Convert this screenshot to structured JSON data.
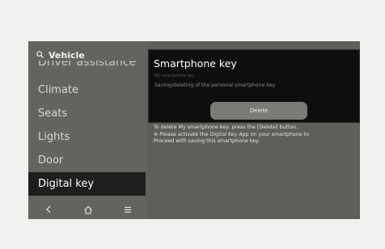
{
  "sidebar": {
    "search_label": "Vehicle",
    "cut_item": "Driver assistance",
    "items": [
      "Climate",
      "Seats",
      "Lights",
      "Door",
      "Digital key"
    ],
    "active_index": 4
  },
  "dialog": {
    "title": "Smartphone key",
    "faded_line": "My smartphone key",
    "body": "Saving/deleting of the personal smartphone key",
    "delete_label": "Delete"
  },
  "info": {
    "line1": "To delete My smartphone key, press the [Delete] button.",
    "line2": "※ Please activate the Digital Key App on your smartphone to",
    "line3": "Proceed with saving this smartphone key."
  },
  "colors": {
    "screen": "#5e5f5b",
    "active_item": "#1d1e1d",
    "dialog": "#0e0e0e"
  }
}
